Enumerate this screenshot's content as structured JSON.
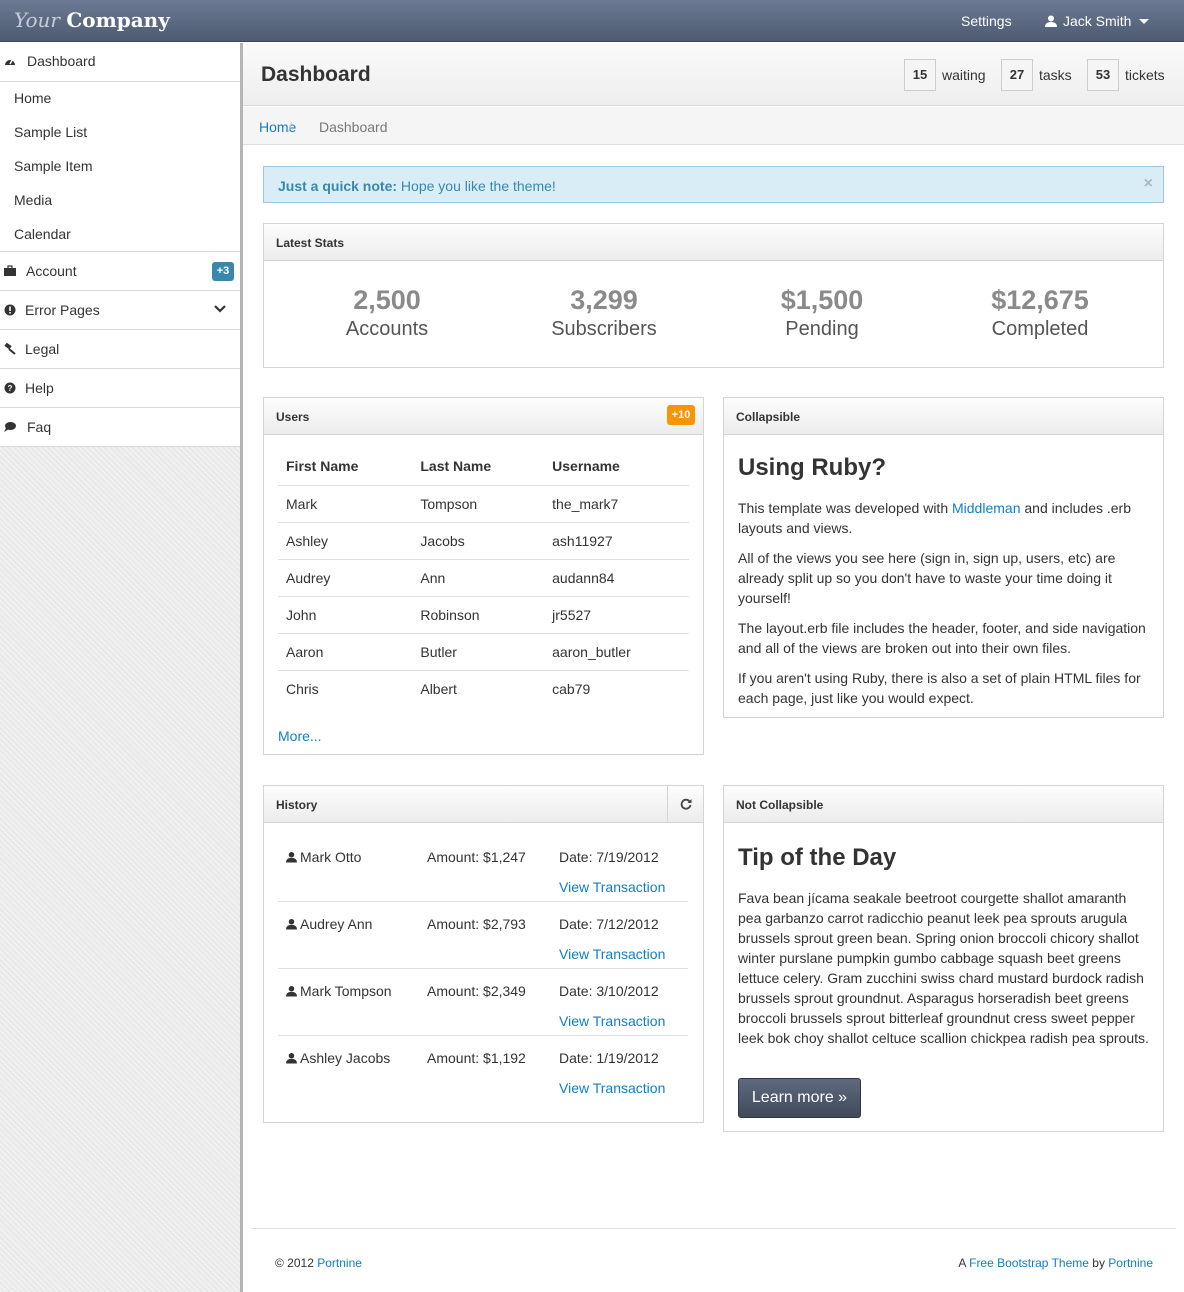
{
  "brand": {
    "italic": "Your",
    "bold": "Company"
  },
  "topnav": {
    "settings": "Settings",
    "user": "Jack Smith"
  },
  "sidebar": {
    "dashboard": "Dashboard",
    "sub_items": [
      "Home",
      "Sample List",
      "Sample Item",
      "Media",
      "Calendar"
    ],
    "account": "Account",
    "account_badge": "+3",
    "error_pages": "Error Pages",
    "legal": "Legal",
    "help": "Help",
    "faq": "Faq"
  },
  "header": {
    "title": "Dashboard",
    "stats": [
      {
        "count": "15",
        "label": "waiting"
      },
      {
        "count": "27",
        "label": "tasks"
      },
      {
        "count": "53",
        "label": "tickets"
      }
    ]
  },
  "breadcrumb": {
    "home": "Home",
    "sep": "/",
    "current": "Dashboard"
  },
  "alert": {
    "strong": "Just a quick note:",
    "text": " Hope you like the theme!",
    "close": "×"
  },
  "latest_stats": {
    "title": "Latest Stats",
    "items": [
      {
        "value": "2,500",
        "caption": "Accounts"
      },
      {
        "value": "3,299",
        "caption": "Subscribers"
      },
      {
        "value": "$1,500",
        "caption": "Pending"
      },
      {
        "value": "$12,675",
        "caption": "Completed"
      }
    ]
  },
  "users": {
    "title": "Users",
    "badge": "+10",
    "columns": [
      "First Name",
      "Last Name",
      "Username"
    ],
    "rows": [
      [
        "Mark",
        "Tompson",
        "the_mark7"
      ],
      [
        "Ashley",
        "Jacobs",
        "ash11927"
      ],
      [
        "Audrey",
        "Ann",
        "audann84"
      ],
      [
        "John",
        "Robinson",
        "jr5527"
      ],
      [
        "Aaron",
        "Butler",
        "aaron_butler"
      ],
      [
        "Chris",
        "Albert",
        "cab79"
      ]
    ],
    "more": "More..."
  },
  "collapsible": {
    "title": "Collapsible",
    "heading": "Using Ruby?",
    "p1_before": "This template was developed with ",
    "p1_link": "Middleman",
    "p1_after": " and includes .erb layouts and views.",
    "p2": "All of the views you see here (sign in, sign up, users, etc) are already split up so you don't have to waste your time doing it yourself!",
    "p3": "The layout.erb file includes the header, footer, and side navigation and all of the views are broken out into their own files.",
    "p4": "If you aren't using Ruby, there is also a set of plain HTML files for each page, just like you would expect."
  },
  "history": {
    "title": "History",
    "link_label": "View Transaction",
    "rows": [
      {
        "name": "Mark Otto",
        "amount": "Amount: $1,247",
        "date": "Date: 7/19/2012"
      },
      {
        "name": "Audrey Ann",
        "amount": "Amount: $2,793",
        "date": "Date: 7/12/2012"
      },
      {
        "name": "Mark Tompson",
        "amount": "Amount: $2,349",
        "date": "Date: 3/10/2012"
      },
      {
        "name": "Ashley Jacobs",
        "amount": "Amount: $1,192",
        "date": "Date: 1/19/2012"
      }
    ]
  },
  "not_collapsible": {
    "title": "Not Collapsible",
    "heading": "Tip of the Day",
    "body": "Fava bean jícama seakale beetroot courgette shallot amaranth pea garbanzo carrot radicchio peanut leek pea sprouts arugula brussels sprout green bean. Spring onion broccoli chicory shallot winter purslane pumpkin gumbo cabbage squash beet greens lettuce celery. Gram zucchini swiss chard mustard burdock radish brussels sprout groundnut. Asparagus horseradish beet greens broccoli brussels sprout bitterleaf groundnut cress sweet pepper leek bok choy shallot celtuce scallion chickpea radish pea sprouts.",
    "button": "Learn more »"
  },
  "footer": {
    "copyright": "© 2012 ",
    "left_link": "Portnine",
    "right_prefix": "A ",
    "right_link1": "Free Bootstrap Theme",
    "right_mid": " by ",
    "right_link2": "Portnine"
  }
}
